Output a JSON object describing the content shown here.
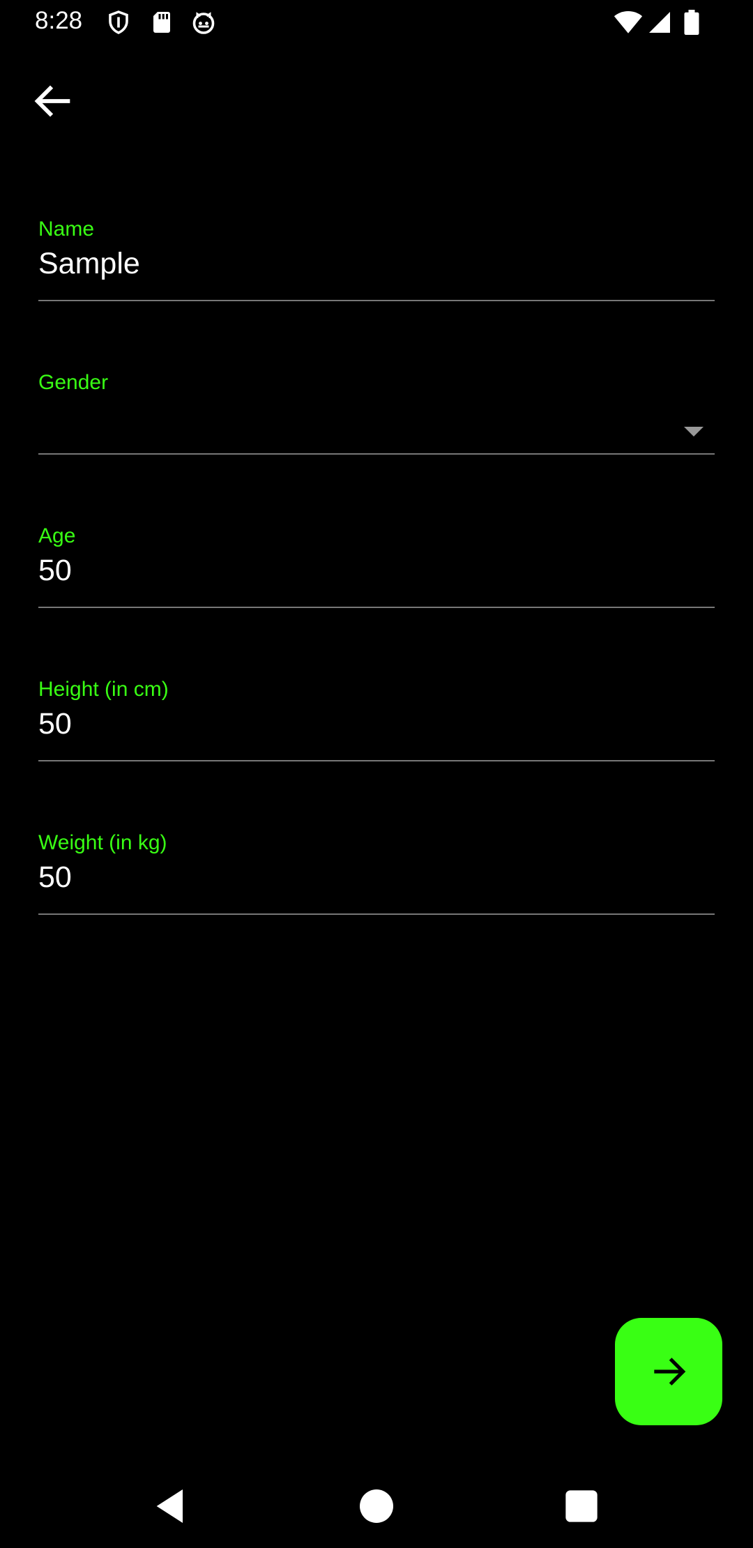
{
  "status_bar": {
    "time": "8:28",
    "left_icons": [
      "shield-icon",
      "sd-card-icon",
      "cat-face-icon"
    ],
    "right_icons": [
      "wifi-icon",
      "cell-signal-icon",
      "battery-icon"
    ]
  },
  "app_bar": {
    "back_icon": "arrow-left-icon"
  },
  "form": {
    "name": {
      "label": "Name",
      "value": "Sample"
    },
    "gender": {
      "label": "Gender",
      "value": ""
    },
    "age": {
      "label": "Age",
      "value": "50"
    },
    "height": {
      "label": "Height (in cm)",
      "value": "50"
    },
    "weight": {
      "label": "Weight (in kg)",
      "value": "50"
    }
  },
  "fab": {
    "icon": "arrow-right-icon"
  },
  "nav": {
    "buttons": [
      "back-triangle-icon",
      "home-circle-icon",
      "recents-square-icon"
    ]
  },
  "colors": {
    "accent": "#39ff14",
    "background": "#000000",
    "text": "#ffffff",
    "underline": "#777777"
  }
}
